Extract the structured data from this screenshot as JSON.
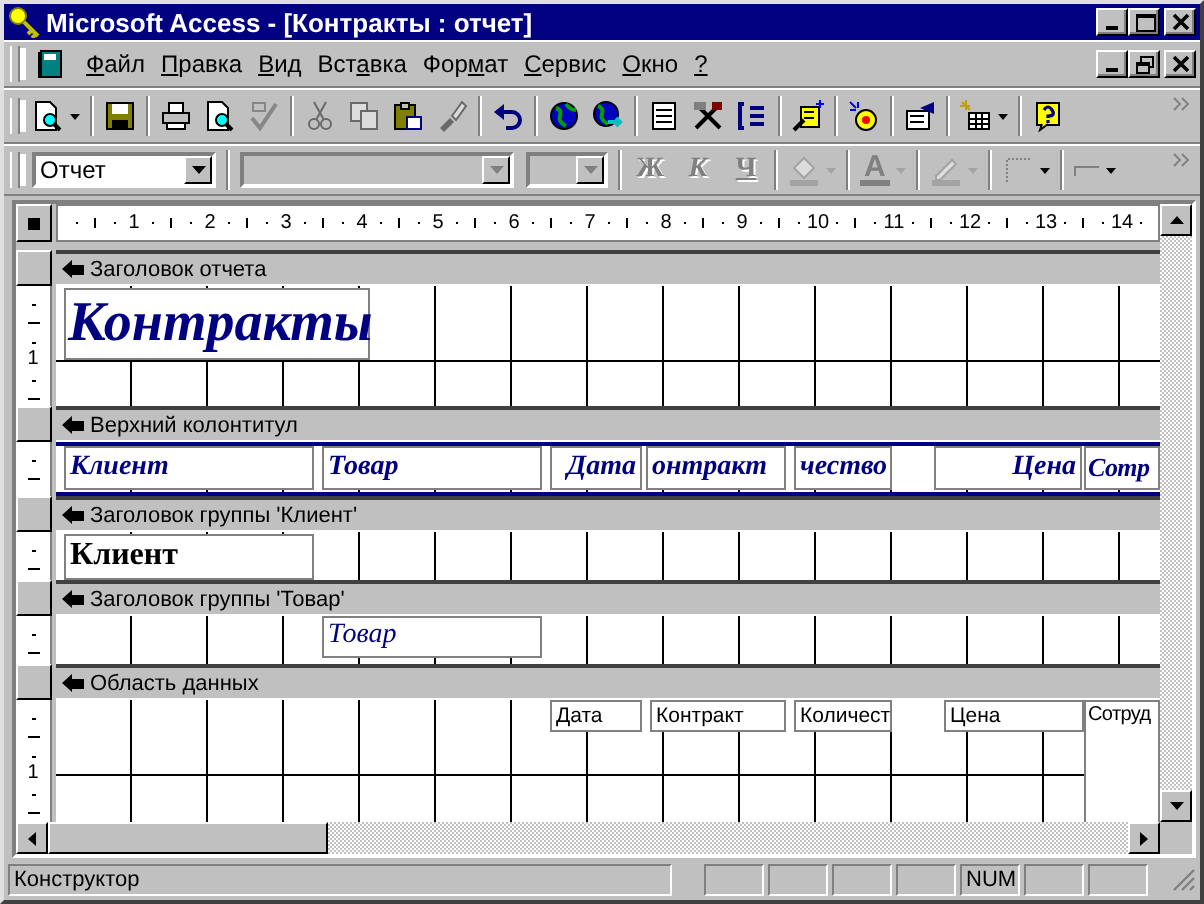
{
  "window": {
    "title": "Microsoft Access - [Контракты : отчет]"
  },
  "menu": [
    {
      "key": "Ф",
      "rest": "айл"
    },
    {
      "key": "П",
      "rest": "равка"
    },
    {
      "key": "В",
      "rest": "ид"
    },
    {
      "lead": "Вст",
      "key": "а",
      "rest": "вка"
    },
    {
      "lead": "Фор",
      "key": "м",
      "rest": "ат"
    },
    {
      "key": "С",
      "rest": "ервис"
    },
    {
      "key": "О",
      "rest": "кно"
    },
    {
      "key": "?"
    }
  ],
  "toolbar": [
    {
      "kind": "button",
      "disabled": false,
      "dropdown": true
    },
    {
      "kind": "separator"
    },
    {
      "kind": "button",
      "disabled": false,
      "dropdown": false
    },
    {
      "kind": "separator"
    },
    {
      "kind": "button",
      "disabled": false,
      "dropdown": false
    },
    {
      "kind": "button",
      "disabled": false,
      "dropdown": false
    },
    {
      "kind": "button",
      "disabled": true,
      "dropdown": false
    },
    {
      "kind": "separator"
    },
    {
      "kind": "button",
      "disabled": true,
      "dropdown": false
    },
    {
      "kind": "button",
      "disabled": true,
      "dropdown": false
    },
    {
      "kind": "button",
      "disabled": false,
      "dropdown": false
    },
    {
      "kind": "button",
      "disabled": true,
      "dropdown": false
    },
    {
      "kind": "separator"
    },
    {
      "kind": "button",
      "disabled": false,
      "dropdown": false
    },
    {
      "kind": "separator"
    },
    {
      "kind": "button",
      "disabled": false,
      "dropdown": false
    },
    {
      "kind": "button",
      "disabled": false,
      "dropdown": false
    },
    {
      "kind": "separator"
    },
    {
      "kind": "button",
      "disabled": false,
      "dropdown": false
    },
    {
      "kind": "button",
      "disabled": false,
      "dropdown": false
    },
    {
      "kind": "button",
      "disabled": false,
      "dropdown": false
    },
    {
      "kind": "separator"
    },
    {
      "kind": "button",
      "disabled": false,
      "dropdown": false
    },
    {
      "kind": "separator"
    },
    {
      "kind": "button",
      "disabled": false,
      "dropdown": false
    },
    {
      "kind": "separator"
    },
    {
      "kind": "button",
      "disabled": false,
      "dropdown": false
    },
    {
      "kind": "separator"
    },
    {
      "kind": "button",
      "disabled": false,
      "dropdown": true
    },
    {
      "kind": "separator"
    },
    {
      "kind": "button",
      "disabled": false,
      "dropdown": false
    }
  ],
  "formatting": {
    "object_box": {
      "value": "Отчет",
      "disabled": false
    },
    "font_box": {
      "disabled": true
    },
    "size_box": {
      "disabled": true
    },
    "style_buttons": [
      {
        "label": "Ж",
        "disabled": true
      },
      {
        "label": "К",
        "disabled": true
      },
      {
        "label": "Ч",
        "disabled": true
      }
    ],
    "tools": [
      {
        "kind": "fill",
        "disabled": true
      },
      {
        "kind": "font_color",
        "label": "A",
        "disabled": true
      },
      {
        "kind": "line_color",
        "disabled": true
      },
      {
        "kind": "border_width",
        "disabled": false
      },
      {
        "kind": "effect",
        "disabled": false
      }
    ]
  },
  "ruler": {
    "marks": [
      "1",
      "2",
      "3",
      "4",
      "5",
      "6",
      "7",
      "8",
      "9",
      "10",
      "11",
      "12",
      "13",
      "14"
    ]
  },
  "sections": [
    {
      "title": "Заголовок отчета",
      "kind": "report_header",
      "ruler_marks": [
        "1"
      ],
      "controls": [
        {
          "kind": "title",
          "text": "Контракты"
        }
      ]
    },
    {
      "title": "Верхний колонтитул",
      "kind": "page_header",
      "controls": [
        {
          "kind": "header",
          "text": "Клиент"
        },
        {
          "kind": "header",
          "text": "Товар"
        },
        {
          "kind": "header",
          "text": "Дата"
        },
        {
          "kind": "header",
          "text": "онтракт"
        },
        {
          "kind": "header",
          "text": "чество"
        },
        {
          "kind": "header",
          "text": "Цена"
        },
        {
          "kind": "header",
          "text": "Сотр"
        }
      ]
    },
    {
      "title": "Заголовок группы 'Клиент'",
      "kind": "group_header",
      "controls": [
        {
          "kind": "group",
          "text": "Клиент"
        }
      ]
    },
    {
      "title": "Заголовок группы 'Товар'",
      "kind": "group_header",
      "controls": [
        {
          "kind": "subgroup",
          "text": "Товар"
        }
      ]
    },
    {
      "title": "Область данных",
      "kind": "detail",
      "ruler_marks": [
        "1"
      ],
      "controls": [
        {
          "kind": "field",
          "text": "Дата"
        },
        {
          "kind": "field",
          "text": "Контракт"
        },
        {
          "kind": "field",
          "text": "Количест"
        },
        {
          "kind": "field",
          "text": "Цена"
        },
        {
          "kind": "field",
          "text": "Сотруд"
        }
      ]
    }
  ],
  "status_bar": {
    "message": "Конструктор",
    "indicator": "NUM"
  }
}
